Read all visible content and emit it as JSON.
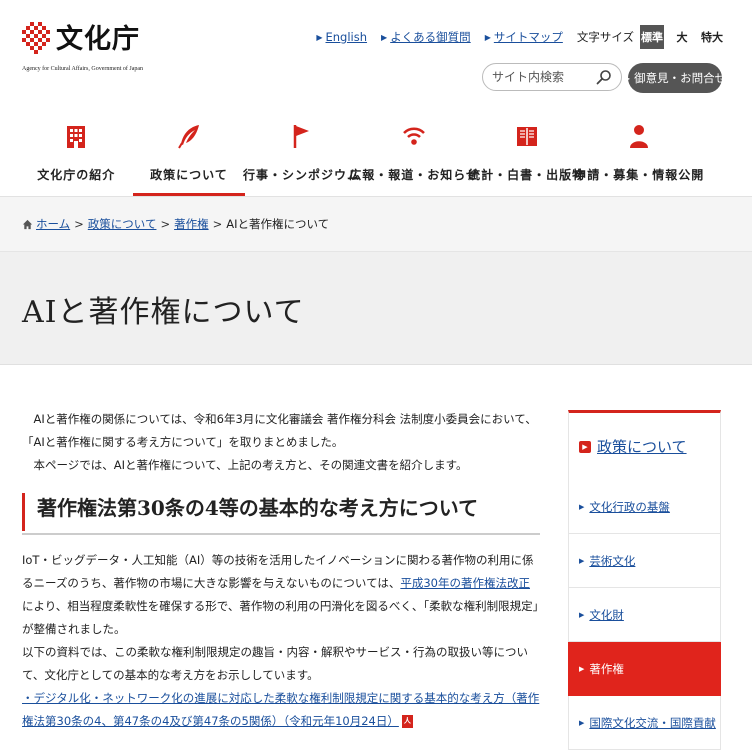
{
  "logo": {
    "name": "文化庁",
    "sub": "Agency for Cultural Affairs, Government of Japan"
  },
  "utility": {
    "links": [
      "English",
      "よくある御質問",
      "サイトマップ"
    ],
    "font_size_label": "文字サイズ",
    "font_sizes": [
      "標準",
      "大",
      "特大"
    ]
  },
  "search": {
    "placeholder": "サイト内検索"
  },
  "feedback_label": "御意見・お問合せ",
  "gnav": [
    {
      "label": "文化庁の紹介",
      "icon": "building-icon"
    },
    {
      "label": "政策について",
      "icon": "quill-pen-icon"
    },
    {
      "label": "行事・シンポジウム",
      "icon": "flag-icon"
    },
    {
      "label": "広報・報道・お知らせ",
      "icon": "broadcast-icon"
    },
    {
      "label": "統計・白書・出版物",
      "icon": "book-icon"
    },
    {
      "label": "申請・募集・情報公開",
      "icon": "person-icon"
    }
  ],
  "breadcrumb": {
    "items": [
      "ホーム",
      "政策について",
      "著作権"
    ],
    "current": "AIと著作権について"
  },
  "page_title": "AIと著作権について",
  "intro": [
    "AIと著作権の関係については、令和6年3月に文化審議会 著作権分科会 法制度小委員会において、「AIと著作権に関する考え方について」を取りまとめました。",
    "本ページでは、AIと著作権について、上記の考え方と、その関連文書を紹介します。"
  ],
  "section": {
    "heading": "著作権法第30条の4等の基本的な考え方について",
    "para1_before": "IoT・ビッグデータ・人工知能（AI）等の技術を活用したイノベーションに関わる著作物の利用に係るニーズのうち、著作物の市場に大きな影響を与えないものについては、",
    "para1_link": "平成30年の著作権法改正",
    "para1_after": "により、相当程度柔軟性を確保する形で、著作物の利用の円滑化を図るべく、「柔軟な権利制限規定」が整備されました。",
    "para2": "以下の資料では、この柔軟な権利制限規定の趣旨・内容・解釈やサービス・行為の取扱い等について、文化庁としての基本的な考え方をお示ししています。",
    "doc_link": "・デジタル化・ネットワーク化の進展に対応した柔軟な権利制限規定に関する基本的な考え方（著作権法第30条の4、第47条の4及び第47条の5関係）（令和元年10月24日）",
    "pdf_label": "人"
  },
  "sidenav": {
    "heading": "政策について",
    "items": [
      "文化行政の基盤",
      "芸術文化",
      "文化財",
      "著作権",
      "国際文化交流・国際貢献"
    ],
    "active_index": 3
  },
  "colors": {
    "accent": "#d4241c",
    "link": "#1a4f9c"
  }
}
